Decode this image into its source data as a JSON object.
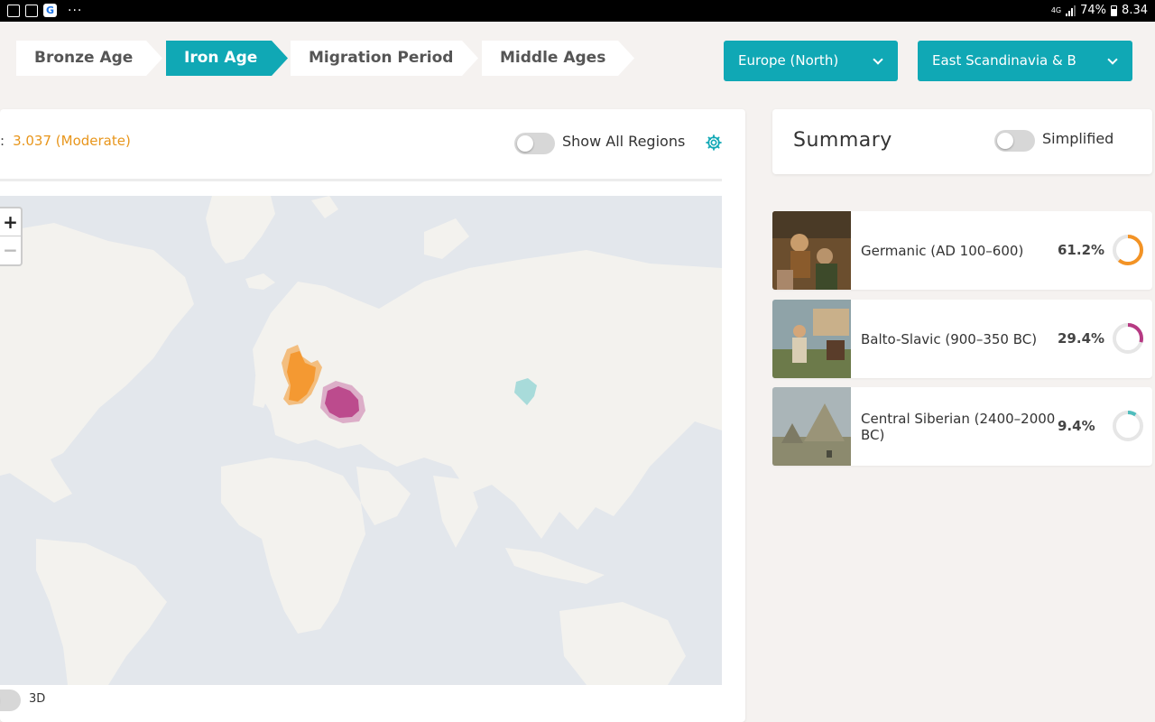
{
  "status_bar": {
    "network": "4G",
    "battery": "74%",
    "time": "8.34",
    "icons": [
      "image-icon",
      "calendar-icon",
      "google-icon",
      "more-icon"
    ]
  },
  "timeline": {
    "steps": [
      {
        "label": "Bronze Age",
        "active": false
      },
      {
        "label": "Iron Age",
        "active": true
      },
      {
        "label": "Migration Period",
        "active": false
      },
      {
        "label": "Middle Ages",
        "active": false
      }
    ]
  },
  "filters": {
    "region": "Europe (North)",
    "subregion": "East Scandinavia & B"
  },
  "map_panel": {
    "score_prefix": ":",
    "score_value": "3.037 (Moderate)",
    "show_all_regions_label": "Show All Regions",
    "zoom_in": "+",
    "zoom_out": "−",
    "label_3d": "3D"
  },
  "summary": {
    "title": "Summary",
    "simplified_label": "Simplified",
    "results": [
      {
        "name": "Germanic (AD 100–600)",
        "percent": "61.2%",
        "fraction": 0.612,
        "color": "#f39325"
      },
      {
        "name": "Balto-Slavic (900–350 BC)",
        "percent": "29.4%",
        "fraction": 0.294,
        "color": "#b63a83"
      },
      {
        "name": "Central Siberian (2400–2000 BC)",
        "percent": "9.4%",
        "fraction": 0.094,
        "color": "#4fbdbd"
      }
    ]
  },
  "colors": {
    "accent": "#10a8b5",
    "score": "#e8961c",
    "germanic": "#f39325",
    "balto_slavic": "#b63a83",
    "siberian": "#8fd3d3"
  }
}
